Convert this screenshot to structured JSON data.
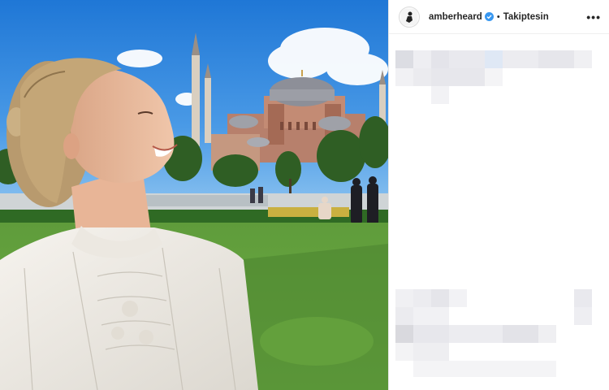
{
  "post": {
    "photo": {
      "alt_subject": "woman-smiling-in-front-of-hagia-sophia"
    },
    "header": {
      "username": "amberheard",
      "verified": true,
      "separator": "•",
      "follow_status": "Takiptesin",
      "more_icon": "more-horizontal-icon",
      "more_label": "•••"
    },
    "caption": {
      "state": "pixelated"
    },
    "colors": {
      "sky": "#2f86dc",
      "grass": "#5c9a3a",
      "verified_badge": "#3897f0",
      "text": "#262626",
      "blur_block": "#e9e9ee"
    }
  }
}
